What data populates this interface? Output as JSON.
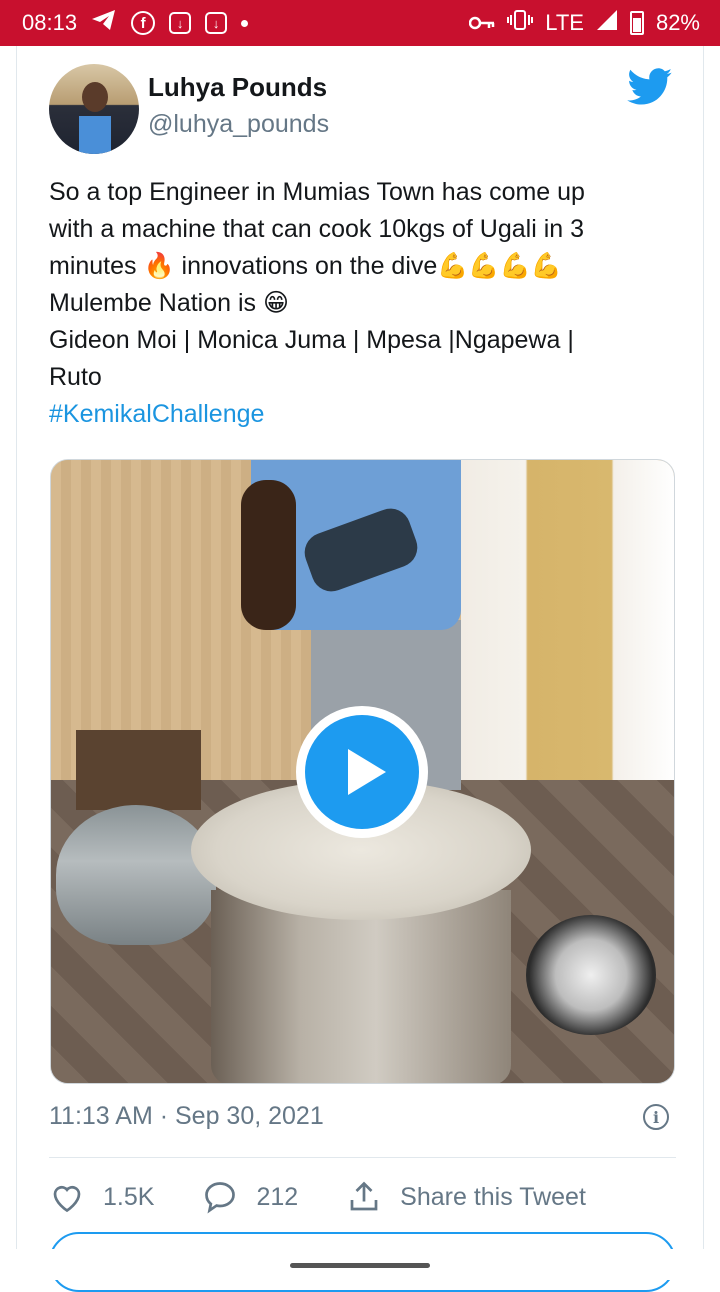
{
  "status_bar": {
    "time": "08:13",
    "network": "LTE",
    "battery": "82%",
    "icons": [
      "telegram-icon",
      "facebook-icon",
      "download-icon",
      "download-icon",
      "notification-dot",
      "key-icon",
      "vibrate-icon",
      "signal-icon",
      "battery-icon"
    ]
  },
  "tweet": {
    "user_name": "Luhya Pounds",
    "handle": "@luhya_pounds",
    "text_lines": [
      "So a top Engineer in Mumias Town has come up",
      "with a machine that can cook 10kgs of Ugali in 3",
      "minutes 🔥 innovations on the dive💪💪💪💪",
      "Mulembe Nation is 😁",
      "Gideon Moi | Monica Juma | Mpesa |Ngapewa |",
      "Ruto"
    ],
    "hashtag": "#KemikalChallenge",
    "timestamp": "11:13 AM · Sep 30, 2021",
    "likes": "1.5K",
    "replies": "212",
    "share_label": "Share this Tweet"
  },
  "colors": {
    "status_bar": "#c8102e",
    "twitter_blue": "#1d9bf0",
    "hashtag": "#1b95e0",
    "muted": "#657786"
  }
}
